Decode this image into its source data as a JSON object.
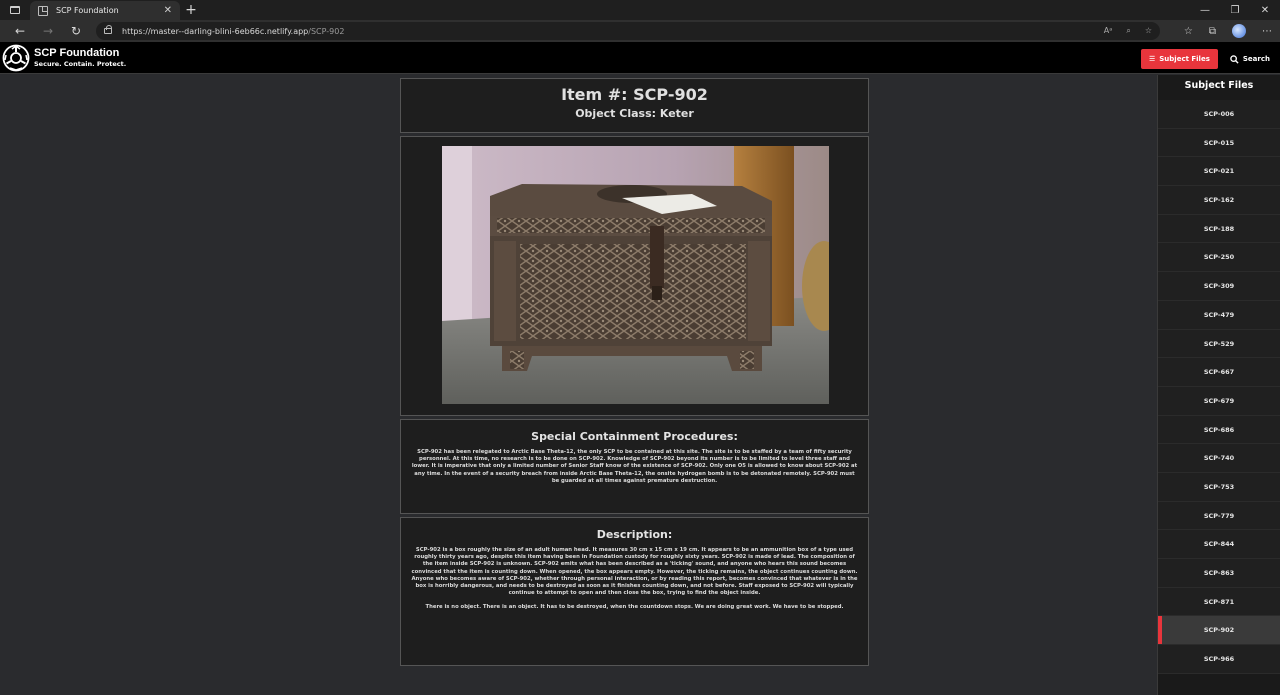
{
  "browser": {
    "tab_title": "SCP Foundation",
    "url_host": "https://master--darling-blini-6eb66c.netlify.app",
    "url_path": "/SCP-902",
    "read_aloud": "Aᵃ",
    "zoom_icon": "zoom-icon"
  },
  "site": {
    "brand_name": "SCP Foundation",
    "tagline": "Secure. Contain. Protect.",
    "subject_files_label": "Subject Files",
    "search_label": "Search",
    "accent_color": "#e8353c"
  },
  "item": {
    "title": "Item #: SCP-902",
    "object_class": "Object Class: Keter"
  },
  "procedures": {
    "heading": "Special Containment Procedures:",
    "body": "SCP-902 has been relegated to Arctic Base Theta-12, the only SCP to be contained at this site. The site is to be staffed by a team of fifty security personnel. At this time, no research is to be done on SCP-902. Knowledge of SCP-902 beyond its number is to be limited to level three staff and lower. It is imperative that only a limited number of Senior Staff know of the existence of SCP-902. Only one O5 is allowed to know about SCP-902 at any time. In the event of a security breach from inside Arctic Base Theta-12, the onsite hydrogen bomb is to be detonated remotely. SCP-902 must be guarded at all times against premature destruction."
  },
  "description": {
    "heading": "Description:",
    "body": "SCP-902 is a box roughly the size of an adult human head. It measures 30 cm x 15 cm x 19 cm. It appears to be an ammunition box of a type used roughly thirty years ago, despite this item having been in Foundation custody for roughly sixty years. SCP-902 is made of lead. The composition of the item inside SCP-902 is unknown. SCP-902 emits what has been described as a 'ticking' sound, and anyone who hears this sound becomes convinced that the item is counting down. When opened, the box appears empty. However, the ticking remains, the object continues counting down. Anyone who becomes aware of SCP-902, whether through personal interaction, or by reading this report, becomes convinced that whatever is in the box is horribly dangerous, and needs to be destroyed as soon as it finishes counting down, and not before. Staff exposed to SCP-902 will typically continue to attempt to open and then close the box, trying to find the object inside.",
    "body2": "There is no object. There is an object. It has to be destroyed, when the countdown stops. We are doing great work. We have to be stopped."
  },
  "sidebar": {
    "title": "Subject Files",
    "items": [
      {
        "label": "SCP-006"
      },
      {
        "label": "SCP-015"
      },
      {
        "label": "SCP-021"
      },
      {
        "label": "SCP-162"
      },
      {
        "label": "SCP-188"
      },
      {
        "label": "SCP-250"
      },
      {
        "label": "SCP-309"
      },
      {
        "label": "SCP-479"
      },
      {
        "label": "SCP-529"
      },
      {
        "label": "SCP-667"
      },
      {
        "label": "SCP-679"
      },
      {
        "label": "SCP-686"
      },
      {
        "label": "SCP-740"
      },
      {
        "label": "SCP-753"
      },
      {
        "label": "SCP-779"
      },
      {
        "label": "SCP-844"
      },
      {
        "label": "SCP-863"
      },
      {
        "label": "SCP-871"
      },
      {
        "label": "SCP-902",
        "active": true
      },
      {
        "label": "SCP-966"
      }
    ]
  }
}
